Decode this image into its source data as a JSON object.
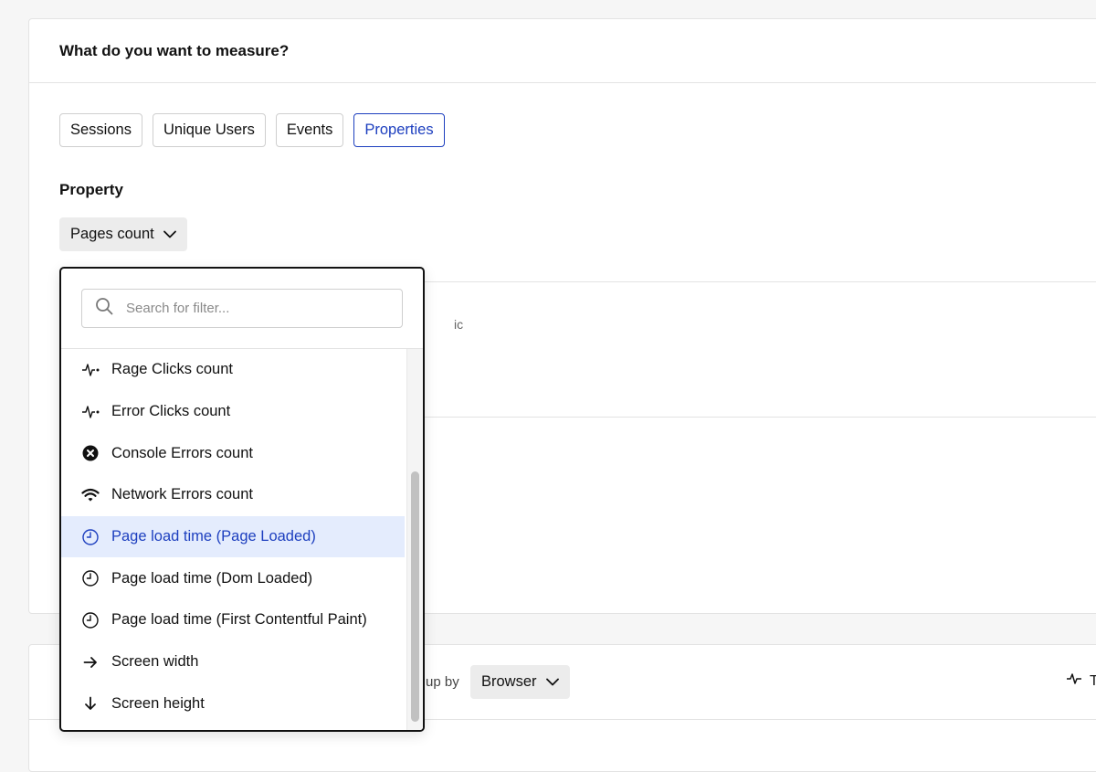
{
  "measure_card": {
    "title": "What do you want to measure?",
    "tabs": [
      {
        "label": "Sessions",
        "active": false
      },
      {
        "label": "Unique Users",
        "active": false
      },
      {
        "label": "Events",
        "active": false
      },
      {
        "label": "Properties",
        "active": true
      }
    ],
    "property_label": "Property",
    "property_select": "Pages count",
    "clipped_text": "ic"
  },
  "group_card": {
    "groupby_label": "up by",
    "groupby_select": "Browser",
    "right_action_label": "T"
  },
  "dropdown": {
    "search_placeholder": "Search for filter...",
    "items": [
      {
        "label": "Rage Clicks count",
        "icon": "pulse-icon"
      },
      {
        "label": "Error Clicks count",
        "icon": "pulse-icon"
      },
      {
        "label": "Console Errors count",
        "icon": "x-circle-icon"
      },
      {
        "label": "Network Errors count",
        "icon": "wifi-icon"
      },
      {
        "label": "Page load time (Page Loaded)",
        "icon": "clock-icon",
        "selected": true
      },
      {
        "label": "Page load time (Dom Loaded)",
        "icon": "clock-icon"
      },
      {
        "label": "Page load time (First Contentful Paint)",
        "icon": "clock-icon"
      },
      {
        "label": "Screen width",
        "icon": "arrow-right-icon"
      },
      {
        "label": "Screen height",
        "icon": "arrow-down-icon"
      }
    ]
  },
  "colors": {
    "accent": "#1d3fbf",
    "selected_bg": "#e4ecfd"
  }
}
